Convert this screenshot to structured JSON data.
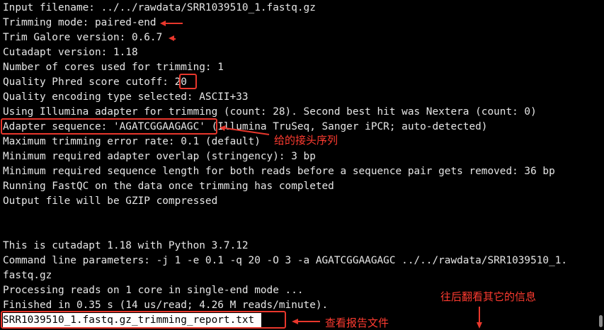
{
  "terminal": {
    "lines": [
      "Input filename: ../../rawdata/SRR1039510_1.fastq.gz",
      "Trimming mode: paired-end",
      "Trim Galore version: 0.6.7",
      "Cutadapt version: 1.18",
      "Number of cores used for trimming: 1",
      "Quality Phred score cutoff: 20",
      "Quality encoding type selected: ASCII+33",
      "Using Illumina adapter for trimming (count: 28). Second best hit was Nextera (count: 0)",
      "Adapter sequence: 'AGATCGGAAGAGC' (Illumina TruSeq, Sanger iPCR; auto-detected)",
      "Maximum trimming error rate: 0.1 (default)",
      "Minimum required adapter overlap (stringency): 3 bp",
      "Minimum required sequence length for both reads before a sequence pair gets removed: 36 bp",
      "Running FastQC on the data once trimming has completed",
      "Output file will be GZIP compressed",
      "",
      "",
      "This is cutadapt 1.18 with Python 3.7.12",
      "Command line parameters: -j 1 -e 0.1 -q 20 -O 3 -a AGATCGGAAGAGC ../../rawdata/SRR1039510_1.",
      "fastq.gz",
      "Processing reads on 1 core in single-end mode ...",
      "Finished in 0.35 s (14 us/read; 4.26 M reads/minute)."
    ],
    "bottom_line": "SRR1039510_1.fastq.gz_trimming_report.txt"
  },
  "annotations": {
    "adapter_note": "给的接头序列",
    "more_info_note": "往后翻看其它的信息",
    "report_note": "查看报告文件"
  },
  "colors": {
    "background": "#000000",
    "text": "#e6e6e6",
    "annotation": "#e8372c"
  }
}
